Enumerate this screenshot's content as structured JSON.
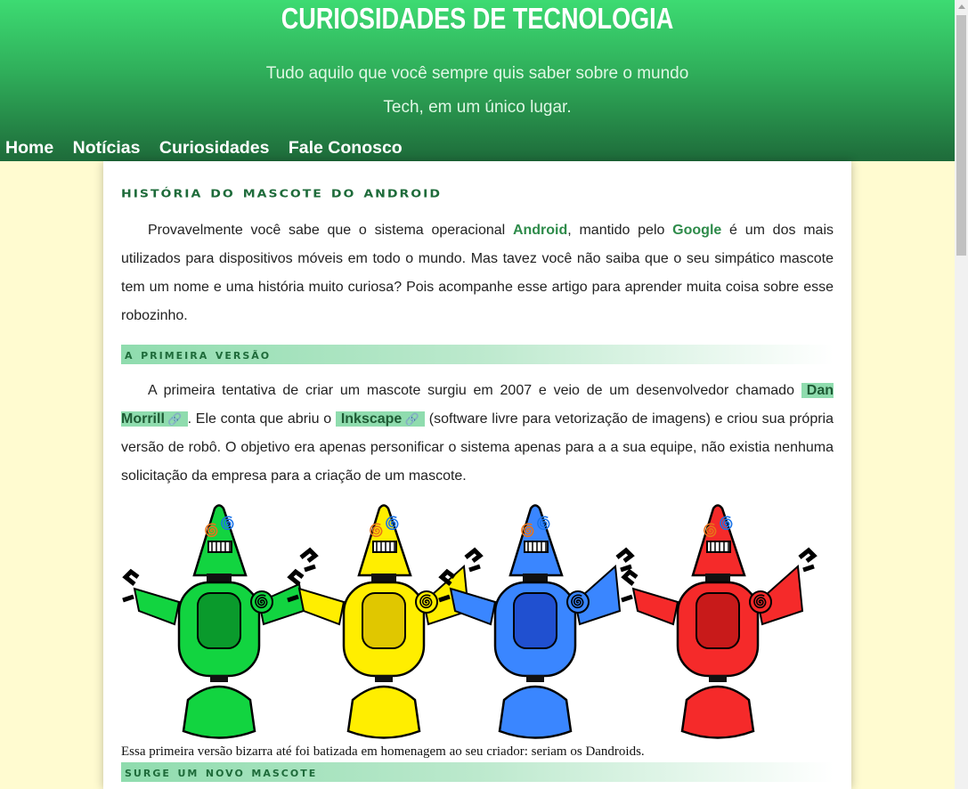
{
  "header": {
    "title": "CURIOSIDADES DE TECNOLOGIA",
    "tagline_line1": "Tudo aquilo que você sempre quis saber sobre o mundo",
    "tagline_line2": "Tech, em um único lugar."
  },
  "nav": [
    {
      "label": "Home"
    },
    {
      "label": "Notícias"
    },
    {
      "label": "Curiosidades"
    },
    {
      "label": "Fale Conosco"
    }
  ],
  "article": {
    "title": "História do mascote do android",
    "intro": {
      "t1": "Provavelmente você sabe que o sistema operacional ",
      "android": "Android",
      "t2": ", mantido pelo ",
      "google": "Google",
      "t3": " é um dos mais utilizados para dispositivos móveis em todo o mundo. Mas tavez você não saiba que o seu simpático mascote tem um nome e uma história muito curiosa? Pois acompanhe esse artigo para aprender muita coisa sobre esse robozinho."
    },
    "section1": {
      "heading": "a primeira versão",
      "t1": "A primeira tentativa de criar um mascote surgiu em 2007 e veio de um desenvolvedor chamado ",
      "link1": "Dan Morrill",
      "t2": ". Ele conta que abriu o ",
      "link2": "Inkscape",
      "t3": " (software livre para vetorização de imagens) e criou sua própria versão de robô. O objetivo era apenas personificar o sistema apenas para a a sua equipe, não existia nenhuma solicitação da empresa para a criação de um mascote.",
      "caption": "Essa primeira versão bizarra até foi batizada em homenagem ao seu criador: seriam os Dandroids."
    },
    "section2": {
      "heading": "surge um novo mascote"
    }
  },
  "colors": {
    "header_top": "#3ddb72",
    "header_bottom": "#1e6b3a",
    "page_bg": "#fffbd0",
    "accent_green": "#2e8b4a",
    "link_tag_bg": "#8fdcae"
  },
  "figure": {
    "robots": [
      {
        "color": "#12d440",
        "dark": "#0a9a2c",
        "name": "green-dandroid"
      },
      {
        "color": "#ffee00",
        "dark": "#e0c700",
        "name": "yellow-dandroid"
      },
      {
        "color": "#3a86ff",
        "dark": "#2050d0",
        "name": "blue-dandroid"
      },
      {
        "color": "#f52a2a",
        "dark": "#c81a1a",
        "name": "red-dandroid"
      }
    ]
  }
}
